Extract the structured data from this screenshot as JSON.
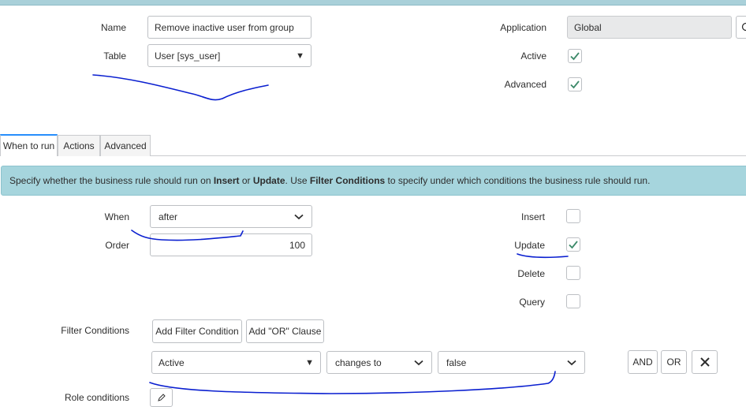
{
  "form": {
    "name_label": "Name",
    "name_value": "Remove inactive user from group",
    "table_label": "Table",
    "table_value": "User [sys_user]",
    "application_label": "Application",
    "application_value": "Global",
    "active_label": "Active",
    "active_checked": true,
    "advanced_label": "Advanced",
    "advanced_checked": true
  },
  "tabs": [
    {
      "label": "When to run",
      "active": true
    },
    {
      "label": "Actions",
      "active": false
    },
    {
      "label": "Advanced",
      "active": false
    }
  ],
  "info": {
    "t1": "Specify whether the business rule should run on ",
    "b1": "Insert",
    "t2": " or ",
    "b2": "Update",
    "t3": ". Use ",
    "b3": "Filter Conditions",
    "t4": " to specify under which conditions the business rule should run."
  },
  "when_to_run": {
    "when_label": "When",
    "when_value": "after",
    "order_label": "Order",
    "order_value": "100",
    "insert_label": "Insert",
    "insert_checked": false,
    "update_label": "Update",
    "update_checked": true,
    "delete_label": "Delete",
    "delete_checked": false,
    "query_label": "Query",
    "query_checked": false
  },
  "filter": {
    "label": "Filter Conditions",
    "add_condition": "Add Filter Condition",
    "add_or": "Add \"OR\" Clause",
    "field": "Active",
    "operator": "changes to",
    "value": "false",
    "and_label": "AND",
    "or_label": "OR"
  },
  "role_conditions_label": "Role conditions",
  "colors": {
    "check": "#3d8a6a",
    "annotation_ink": "#0a1fd0",
    "info_bg": "#a6d5dd",
    "tab_accent": "#278efc"
  }
}
